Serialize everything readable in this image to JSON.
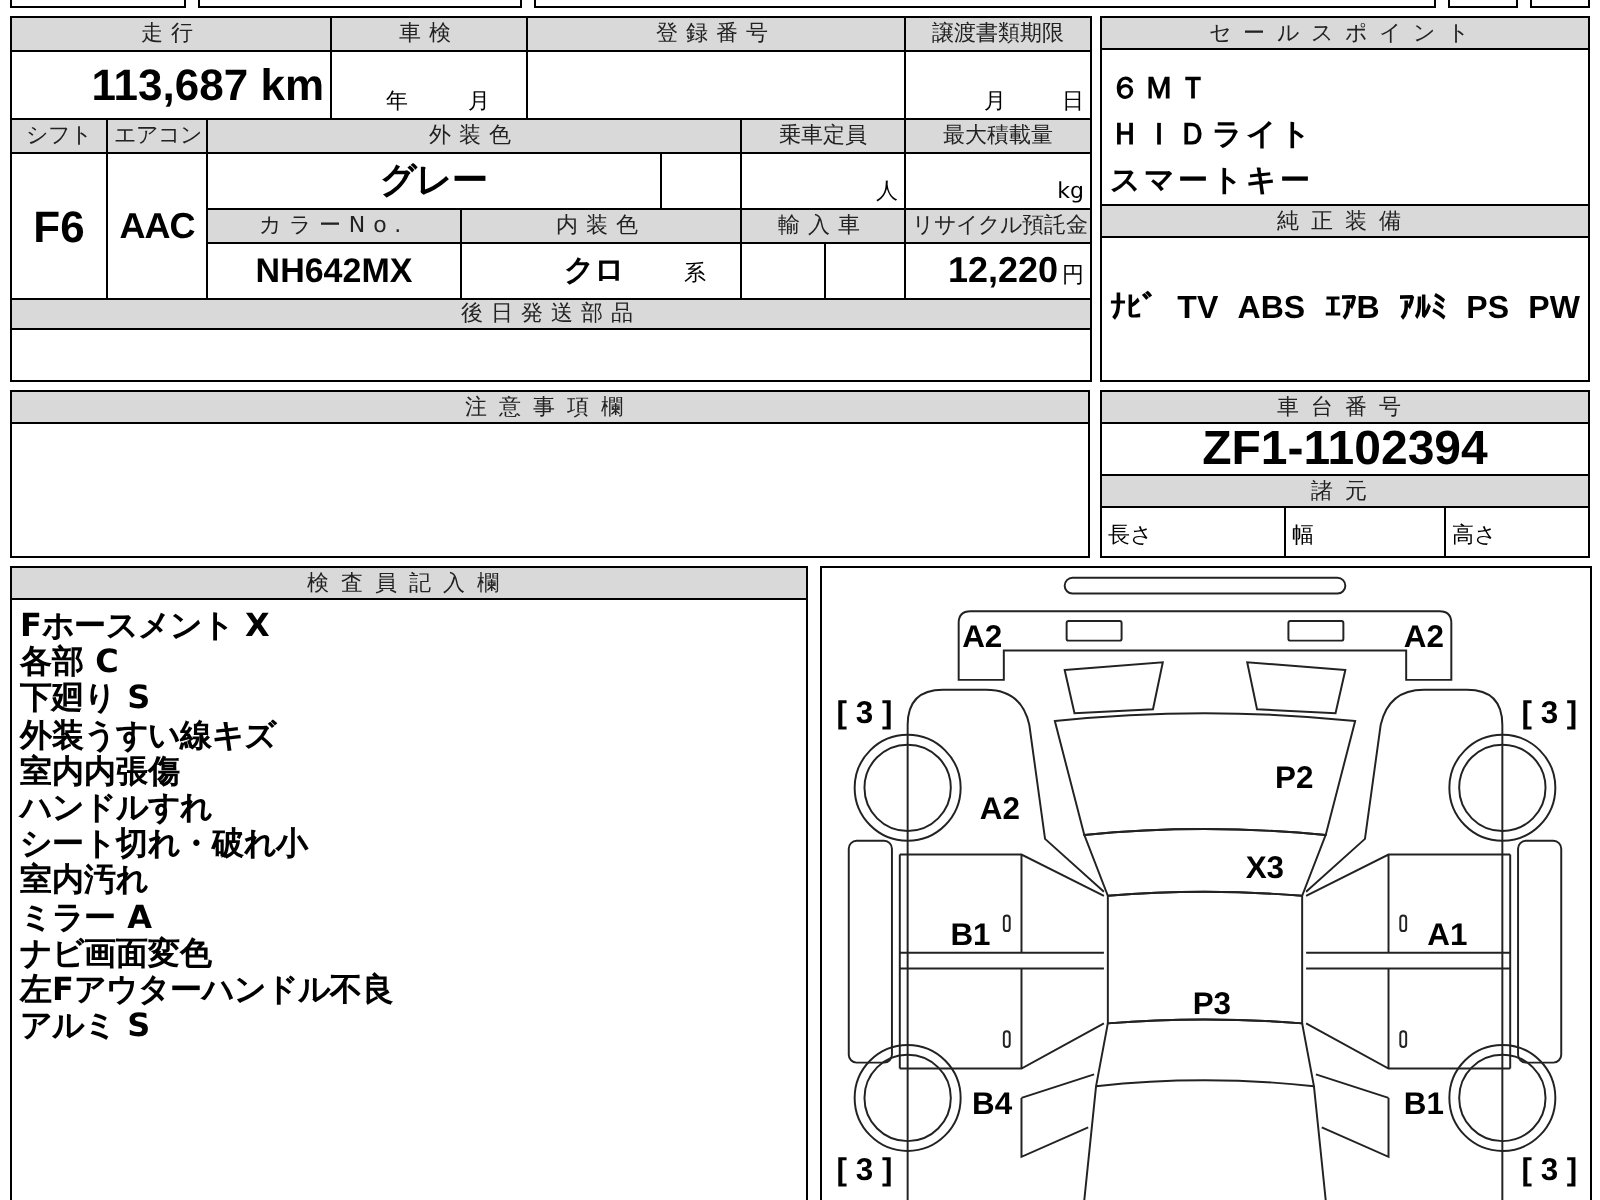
{
  "spec_table": {
    "mileage_label": "走行",
    "mileage": "113,687 km",
    "inspection_label": "車検",
    "inspection_year_unit": "年",
    "inspection_month_unit": "月",
    "registration_label": "登録番号",
    "transfer_deadline_label": "譲渡書類期限",
    "transfer_month_unit": "月",
    "transfer_day_unit": "日",
    "shift_label": "シフト",
    "aircon_label": "エアコン",
    "exterior_color_label": "外装色",
    "capacity_label": "乗車定員",
    "max_load_label": "最大積載量",
    "shift": "F6",
    "aircon": "AAC",
    "exterior_color": "グレー",
    "capacity_unit": "人",
    "max_load_unit": "kg",
    "color_no_label": "カラーNo.",
    "interior_color_label": "内装色",
    "import_label": "輸入車",
    "recycle_label": "リサイクル預託金",
    "color_no": "NH642MX",
    "interior_color": "クロ",
    "interior_color_suffix": "系",
    "recycle_fee": "12,220",
    "recycle_unit": "円",
    "parts_label": "後日発送部品"
  },
  "sales_points": {
    "title": "セールスポイント",
    "items": [
      "６ＭＴ",
      "ＨＩＤライト",
      "スマートキー"
    ]
  },
  "equipment": {
    "title": "純正装備",
    "items": [
      "ﾅﾋﾞ",
      "TV",
      "ABS",
      "ｴｱB",
      "ｱﾙﾐ",
      "PS",
      "PW"
    ]
  },
  "notes": {
    "title": "注意事項欄"
  },
  "chassis": {
    "title": "車台番号",
    "number": "ZF1-1102394",
    "specs_title": "諸元",
    "specs": [
      "長さ",
      "幅",
      "高さ"
    ]
  },
  "inspector_notes": {
    "title": "検査員記入欄",
    "lines": [
      "Fホースメント X",
      "各部 C",
      "下廻り S",
      "外装うすい線キズ",
      "室内内張傷",
      "ハンドルすれ",
      "シート切れ・破れ小",
      "室内汚れ",
      "ミラー A",
      "ナビ画面変色",
      "左Fアウターハンドル不良",
      "アルミ S"
    ]
  },
  "damage_diagram": {
    "marks": [
      {
        "text": "A2"
      },
      {
        "text": "A2"
      },
      {
        "text": "[ 3 ]"
      },
      {
        "text": "[ 3 ]"
      },
      {
        "text": "P2"
      },
      {
        "text": "A2"
      },
      {
        "text": "X3"
      },
      {
        "text": "B1"
      },
      {
        "text": "A1"
      },
      {
        "text": "P3"
      },
      {
        "text": "B4"
      },
      {
        "text": "B1"
      },
      {
        "text": "[ 3 ]"
      },
      {
        "text": "[ 3 ]"
      }
    ]
  }
}
